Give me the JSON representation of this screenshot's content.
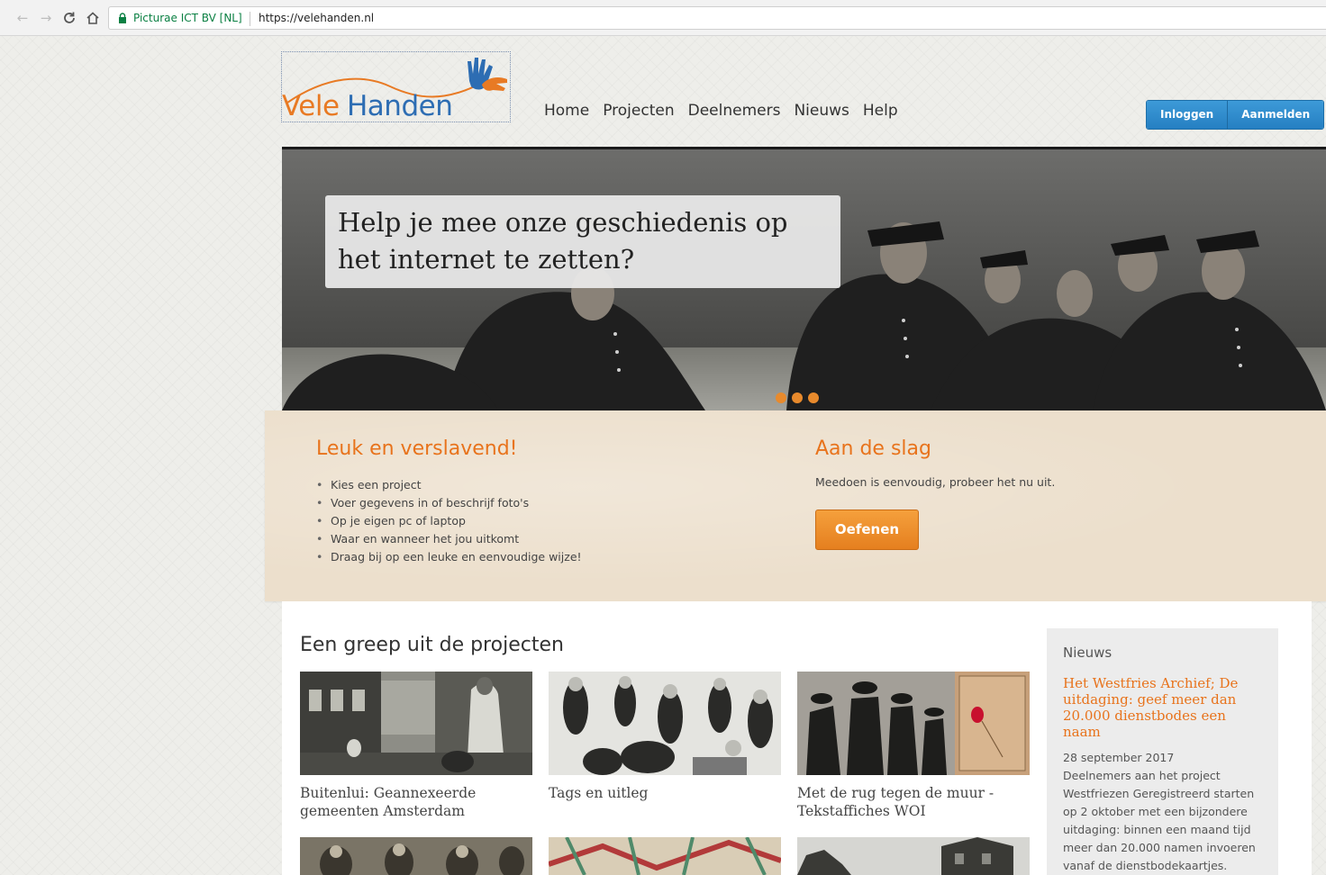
{
  "browser": {
    "back_icon": "arrow-left-icon",
    "forward_icon": "arrow-right-icon",
    "reload_icon": "reload-icon",
    "home_icon": "home-icon",
    "cert_label": "Picturae ICT BV [NL]",
    "url": "https://velehanden.nl",
    "secure_color": "#0b8043"
  },
  "header": {
    "logo": {
      "part1": "Vele",
      "part2": "Handen",
      "color1": "#e87a24",
      "color2": "#2d6db3"
    },
    "nav": [
      "Home",
      "Projecten",
      "Deelnemers",
      "Nieuws",
      "Help"
    ],
    "login_label": "Inloggen",
    "register_label": "Aanmelden"
  },
  "hero": {
    "caption": "Help je mee onze geschiedenis op het internet te zetten?",
    "slide_count": 3,
    "active_slide": 3
  },
  "intro": {
    "left_heading": "Leuk en verslavend!",
    "bullets": [
      "Kies een project",
      "Voer gegevens in of beschrijf foto's",
      "Op je eigen pc of laptop",
      "Waar en wanneer het jou uitkomt",
      "Draag bij op een leuke en eenvoudige wijze!"
    ],
    "right_heading": "Aan de slag",
    "right_text": "Meedoen is eenvoudig, probeer het nu uit.",
    "button_label": "Oefenen",
    "accent_color": "#e8731c"
  },
  "projects": {
    "title": "Een greep uit de projecten",
    "items": [
      {
        "title": "Buitenlui: Geannexeerde gemeenten Amsterdam"
      },
      {
        "title": "Tags en uitleg"
      },
      {
        "title": "Met de rug tegen de muur - Tekstaffiches WOI"
      }
    ]
  },
  "news": {
    "heading": "Nieuws",
    "article_title": "Het Westfries Archief; De uitdaging: geef meer dan 20.000 dienstbodes een naam",
    "date": "28 september 2017",
    "excerpt": "Deelnemers aan het project Westfriezen Geregistreerd starten op 2 oktober met een bijzondere uitdaging: binnen een maand tijd meer dan 20.000 namen invoeren vanaf de dienstbodekaartjes."
  }
}
